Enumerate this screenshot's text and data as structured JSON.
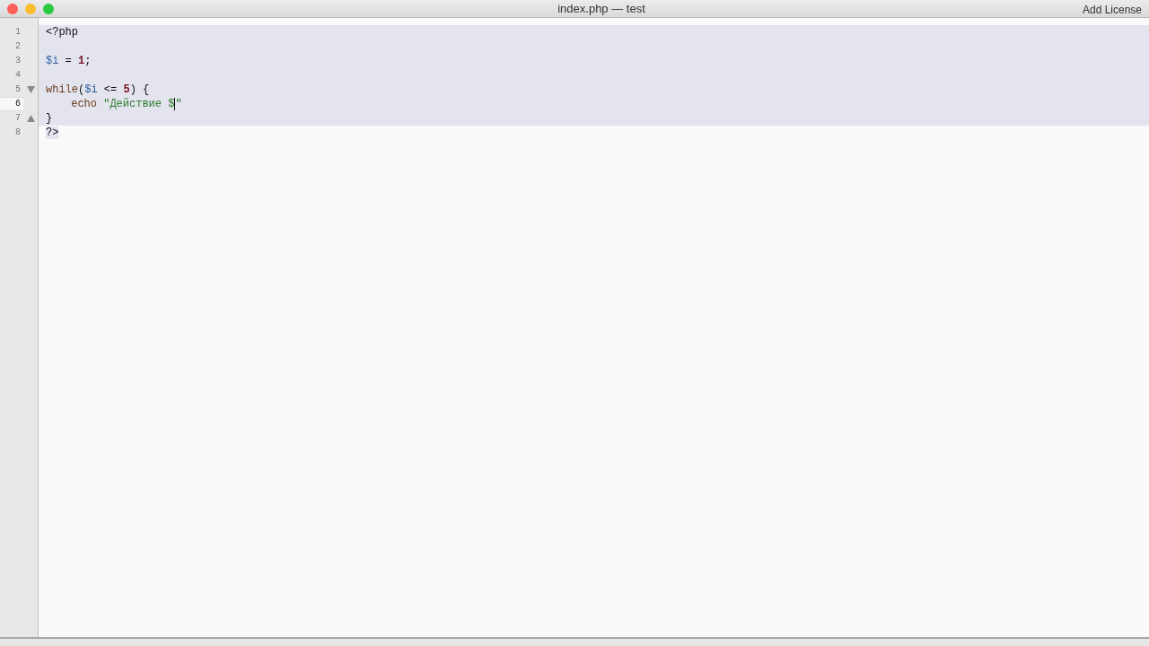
{
  "window": {
    "title": "index.php — test",
    "action": "Add License"
  },
  "editor": {
    "lines": [
      {
        "number": "1",
        "current": false,
        "selected": true,
        "tokens": [
          {
            "kind": "plain",
            "text": "<?php"
          }
        ]
      },
      {
        "number": "2",
        "current": false,
        "selected": true
      },
      {
        "number": "3",
        "current": false,
        "selected": true,
        "tokens": [
          {
            "kind": "variable",
            "text": "$i"
          },
          {
            "kind": "plain",
            "text": " = "
          },
          {
            "kind": "number",
            "text": "1"
          },
          {
            "kind": "plain",
            "text": ";"
          }
        ]
      },
      {
        "number": "4",
        "current": false,
        "selected": true
      },
      {
        "number": "5",
        "current": false,
        "selected": true,
        "fold_start": true,
        "tokens": [
          {
            "kind": "keyword",
            "text": "while"
          },
          {
            "kind": "plain",
            "text": "("
          },
          {
            "kind": "variable",
            "text": "$i"
          },
          {
            "kind": "plain",
            "text": " <= "
          },
          {
            "kind": "number",
            "text": "5"
          },
          {
            "kind": "plain",
            "text": ") {"
          }
        ]
      },
      {
        "number": "6",
        "current": true,
        "selected": true,
        "indented": true,
        "tokens": [
          {
            "kind": "keyword",
            "text": "echo"
          },
          {
            "kind": "string",
            "text": "\"Действие $",
            "gap_before": true,
            "caret_after": true
          },
          {
            "kind": "string",
            "text": "\""
          }
        ]
      },
      {
        "number": "7",
        "current": false,
        "selected": true,
        "fold_end": true,
        "tokens": [
          {
            "kind": "plain",
            "text": "}"
          }
        ]
      },
      {
        "number": "8",
        "current": false,
        "selected": true,
        "tokens": [
          {
            "kind": "plain",
            "text": "?>"
          }
        ]
      }
    ]
  }
}
